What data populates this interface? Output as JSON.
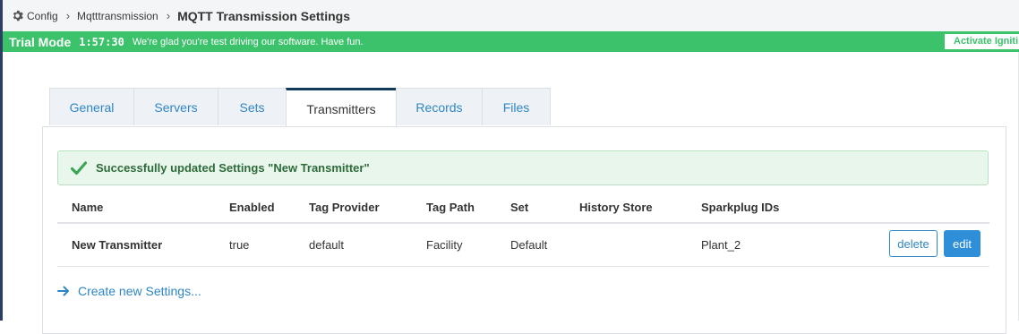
{
  "breadcrumb": {
    "items": [
      "Config",
      "Mqtttransmission"
    ],
    "current": "MQTT Transmission Settings",
    "separator": "›"
  },
  "trial": {
    "mode": "Trial Mode",
    "time": "1:57:30",
    "message": "We're glad you're test driving our software. Have fun.",
    "activate": "Activate Igniti"
  },
  "tabs": [
    {
      "label": "General"
    },
    {
      "label": "Servers"
    },
    {
      "label": "Sets"
    },
    {
      "label": "Transmitters",
      "active": true
    },
    {
      "label": "Records"
    },
    {
      "label": "Files"
    }
  ],
  "alert": {
    "message": "Successfully updated Settings \"New Transmitter\""
  },
  "table": {
    "headers": [
      "Name",
      "Enabled",
      "Tag Provider",
      "Tag Path",
      "Set",
      "History Store",
      "Sparkplug IDs"
    ],
    "rows": [
      {
        "name": "New Transmitter",
        "enabled": "true",
        "tag_provider": "default",
        "tag_path": "Facility",
        "set": "Default",
        "history_store": "",
        "sparkplug_ids": "Plant_2"
      }
    ],
    "actions": {
      "delete": "delete",
      "edit": "edit"
    }
  },
  "create_link": "Create new Settings...",
  "colors": {
    "trial_green": "#3cc26b",
    "link_blue": "#2f86c6",
    "active_tab_border": "#123a5c",
    "success_bg": "#e9f6ec"
  },
  "icons": [
    "gear-icon",
    "chevron-right-icon",
    "checkmark-icon",
    "arrow-right-icon"
  ]
}
